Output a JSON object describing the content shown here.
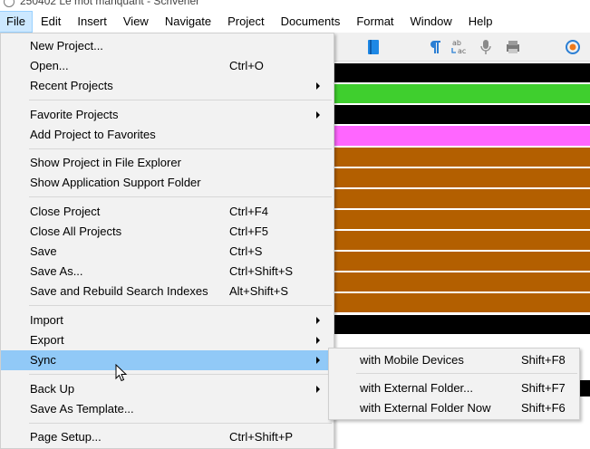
{
  "window": {
    "title": "250402 Le mot manquant - Scrivener"
  },
  "menubar": {
    "items": [
      {
        "label": "File"
      },
      {
        "label": "Edit"
      },
      {
        "label": "Insert"
      },
      {
        "label": "View"
      },
      {
        "label": "Navigate"
      },
      {
        "label": "Project"
      },
      {
        "label": "Documents"
      },
      {
        "label": "Format"
      },
      {
        "label": "Window"
      },
      {
        "label": "Help"
      }
    ],
    "active": "File"
  },
  "file_menu": {
    "items": [
      {
        "label": "New Project...",
        "shortcut": ""
      },
      {
        "label": "Open...",
        "shortcut": "Ctrl+O"
      },
      {
        "label": "Recent Projects",
        "shortcut": ""
      },
      {
        "label": "Favorite Projects",
        "shortcut": ""
      },
      {
        "label": "Add Project to Favorites",
        "shortcut": ""
      },
      {
        "label": "Show Project in File Explorer",
        "shortcut": ""
      },
      {
        "label": "Show Application Support Folder",
        "shortcut": ""
      },
      {
        "label": "Close Project",
        "shortcut": "Ctrl+F4"
      },
      {
        "label": "Close All Projects",
        "shortcut": "Ctrl+F5"
      },
      {
        "label": "Save",
        "shortcut": "Ctrl+S"
      },
      {
        "label": "Save As...",
        "shortcut": "Ctrl+Shift+S"
      },
      {
        "label": "Save and Rebuild Search Indexes",
        "shortcut": "Alt+Shift+S"
      },
      {
        "label": "Import",
        "shortcut": ""
      },
      {
        "label": "Export",
        "shortcut": ""
      },
      {
        "label": "Sync",
        "shortcut": ""
      },
      {
        "label": "Back Up",
        "shortcut": ""
      },
      {
        "label": "Save As Template...",
        "shortcut": ""
      },
      {
        "label": "Page Setup...",
        "shortcut": "Ctrl+Shift+P"
      }
    ],
    "highlighted": "Sync"
  },
  "sync_submenu": {
    "items": [
      {
        "label": "with Mobile Devices",
        "shortcut": "Shift+F8"
      },
      {
        "label": "with External Folder...",
        "shortcut": "Shift+F7"
      },
      {
        "label": "with External Folder Now",
        "shortcut": "Shift+F6"
      }
    ]
  },
  "toolbar": {
    "icons": [
      "bookmark-icon",
      "pilcrow-icon",
      "spellcheck-icon",
      "microphone-icon",
      "print-icon",
      "target-icon"
    ]
  },
  "colors": {
    "menu_bg": "#f2f2f2",
    "highlight": "#91c9f7",
    "menubar_active": "#cce8ff",
    "band_black": "#000000",
    "band_green": "#3fcf2e",
    "band_pink": "#ff66ff",
    "band_orange": "#b35f00"
  }
}
